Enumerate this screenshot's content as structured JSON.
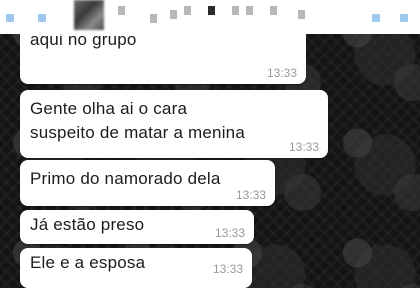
{
  "messages": [
    {
      "text": "Olha o que tão repassando\naqui no grupo",
      "time": "13:33"
    },
    {
      "text": "Gente olha ai o cara\nsuspeito de matar a menina",
      "time": "13:33"
    },
    {
      "text": "Primo do namorado dela",
      "time": "13:33"
    },
    {
      "text": "Já estão preso",
      "time": "13:33"
    },
    {
      "text": "Ele e a esposa",
      "time": "13:33"
    }
  ],
  "colors": {
    "bubble": "#ffffff",
    "timestamp": "#9a9a9a",
    "wallpaper": "#141414"
  },
  "header": {
    "avatar_icon": "blurred-avatar-icon"
  }
}
